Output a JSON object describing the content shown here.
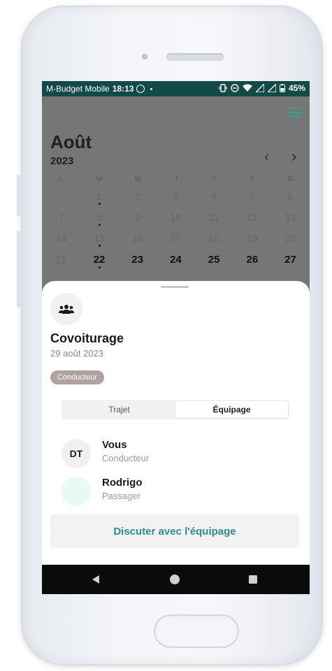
{
  "status_bar": {
    "carrier": "M-Budget Mobile",
    "time": "18:13",
    "battery": "45%"
  },
  "calendar": {
    "month": "Août",
    "year": "2023",
    "weekdays": [
      "L",
      "M",
      "M",
      "J",
      "V",
      "S",
      "D"
    ],
    "weeks": [
      [
        "",
        "1",
        "2",
        "3",
        "4",
        "5",
        "6"
      ],
      [
        "7",
        "8",
        "9",
        "10",
        "11",
        "12",
        "13"
      ],
      [
        "14",
        "15",
        "16",
        "17",
        "18",
        "19",
        "20"
      ],
      [
        "21",
        "22",
        "23",
        "24",
        "25",
        "26",
        "27"
      ]
    ]
  },
  "sheet": {
    "title": "Covoiturage",
    "date": "29 août 2023",
    "role_badge": "Conducteur",
    "tabs": [
      {
        "label": "Trajet",
        "active": false
      },
      {
        "label": "Équipage",
        "active": true
      }
    ],
    "members": [
      {
        "initials": "DT",
        "name": "Vous",
        "role": "Conducteur"
      },
      {
        "initials": "",
        "name": "Rodrigo",
        "role": "Passager"
      }
    ],
    "chat_button": "Discuter avec l'équipage"
  },
  "colors": {
    "status_bar_bg": "#114a46",
    "accent_teal": "#2a8f86",
    "badge_bg": "#b0a2a0"
  }
}
